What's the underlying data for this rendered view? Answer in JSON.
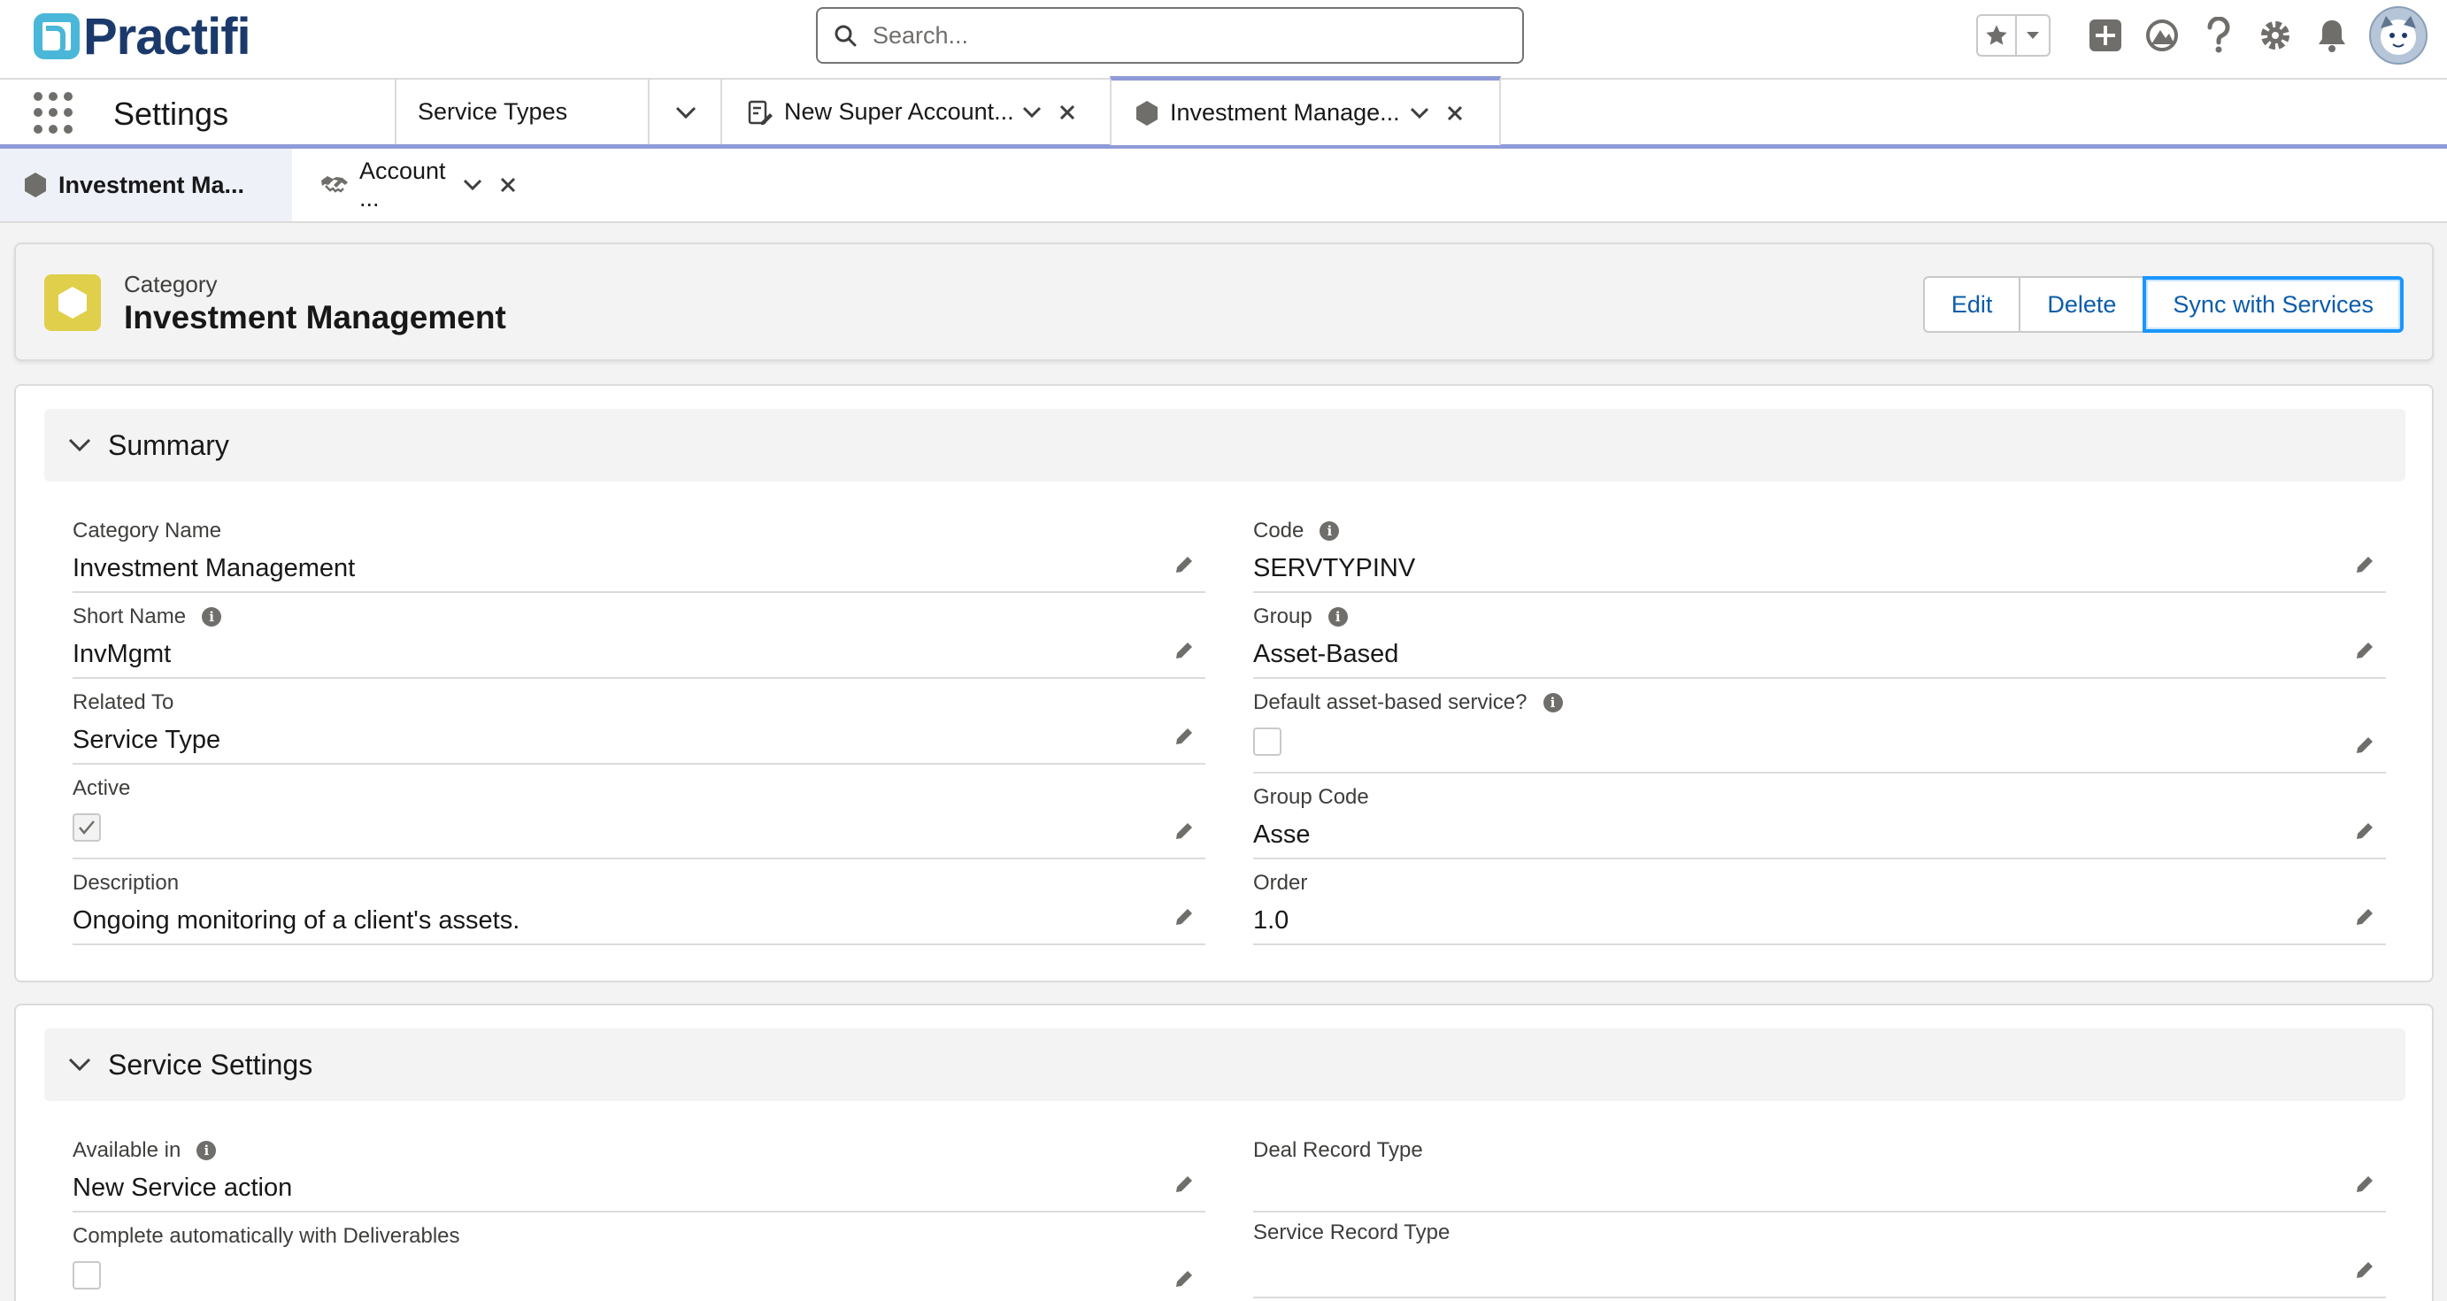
{
  "header": {
    "logo_text": "Practifi",
    "search_placeholder": "Search..."
  },
  "nav": {
    "app_name": "Settings",
    "item_service_types": "Service Types",
    "tabs": [
      {
        "label": "New Super Account...",
        "icon": "edit-record-icon"
      },
      {
        "label": "Investment Manage...",
        "icon": "hexagon-icon"
      }
    ]
  },
  "subtabs": [
    {
      "label": "Investment Ma...",
      "icon": "hexagon-icon"
    },
    {
      "label": "Account ...",
      "icon": "handshake-icon"
    }
  ],
  "record": {
    "type": "Category",
    "title": "Investment Management",
    "buttons": {
      "edit": "Edit",
      "delete": "Delete",
      "sync": "Sync with Services"
    }
  },
  "summary": {
    "title": "Summary",
    "left": [
      {
        "label": "Category Name",
        "value": "Investment Management"
      },
      {
        "label": "Short Name",
        "value": "InvMgmt"
      },
      {
        "label": "Related To",
        "value": "Service Type"
      },
      {
        "label": "Active",
        "checked": true
      },
      {
        "label": "Description",
        "value": "Ongoing monitoring of a client's assets."
      }
    ],
    "right": [
      {
        "label": "Code",
        "value": "SERVTYPINV"
      },
      {
        "label": "Group",
        "value": "Asset-Based"
      },
      {
        "label": "Default asset-based service?",
        "checked": false
      },
      {
        "label": "Group Code",
        "value": "Asse"
      },
      {
        "label": "Order",
        "value": "1.0"
      }
    ]
  },
  "service_settings": {
    "title": "Service Settings",
    "left": [
      {
        "label": "Available in",
        "value": "New Service action"
      },
      {
        "label": "Complete automatically with Deliverables",
        "checked": false
      }
    ],
    "right": [
      {
        "label": "Deal Record Type",
        "value": ""
      },
      {
        "label": "Service Record Type",
        "value": ""
      }
    ]
  },
  "colors": {
    "brand_navy": "#1b3a6b",
    "brand_teal": "#4ab7d8",
    "link_blue": "#0b5cab",
    "tab_accent": "#8f9ad8",
    "category_icon": "#e0cf4a"
  }
}
